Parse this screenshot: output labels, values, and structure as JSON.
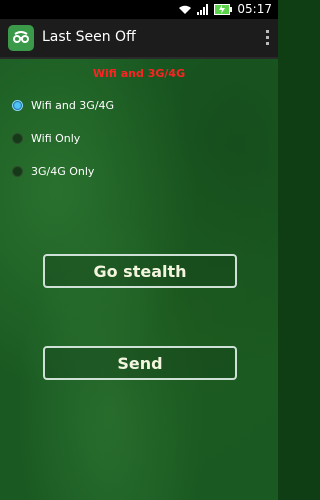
{
  "status_bar": {
    "time": "05:17"
  },
  "action_bar": {
    "title": "Last Seen Off"
  },
  "content": {
    "heading": "Wifi and 3G/4G",
    "options": [
      {
        "label": "Wifi and 3G/4G",
        "checked": true
      },
      {
        "label": "Wifi Only",
        "checked": false
      },
      {
        "label": "3G/4G Only",
        "checked": false
      }
    ],
    "buttons": {
      "go_stealth": "Go stealth",
      "send": "Send"
    }
  },
  "icons": {
    "wifi": "wifi-icon",
    "signal": "signal-icon",
    "battery": "battery-charging-icon",
    "app": "app-logo-icon",
    "overflow": "overflow-menu-icon"
  },
  "colors": {
    "heading": "#ff2222",
    "radio_selected": "#4fc3f7",
    "button_text": "#f3f5df"
  }
}
